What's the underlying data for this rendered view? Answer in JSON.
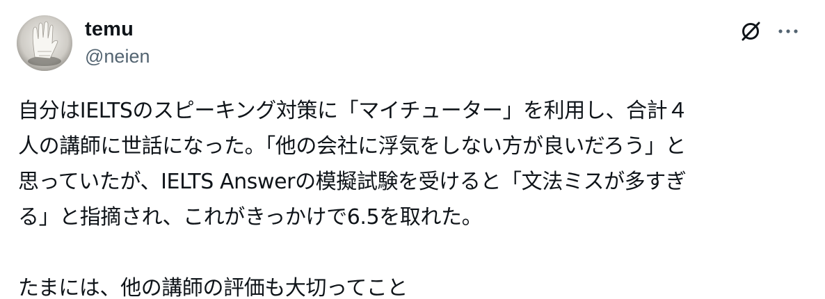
{
  "post": {
    "author": {
      "display_name": "temu",
      "handle": "@neien"
    },
    "icons": {
      "brand": "x-premium-slash-icon",
      "more": "more-options-icon"
    },
    "body_lines": [
      "自分はIELTSのスピーキング対策に「マイチューター」を利用し、合計４",
      "人の講師に世話になった。「他の会社に浮気をしない方が良いだろう」と",
      "思っていたが、IELTS Answerの模擬試験を受けると「文法ミスが多すぎ",
      "る」と指摘され、これがきっかけで6.5を取れた。",
      "たまには、他の講師の評価も大切ってこと"
    ]
  }
}
